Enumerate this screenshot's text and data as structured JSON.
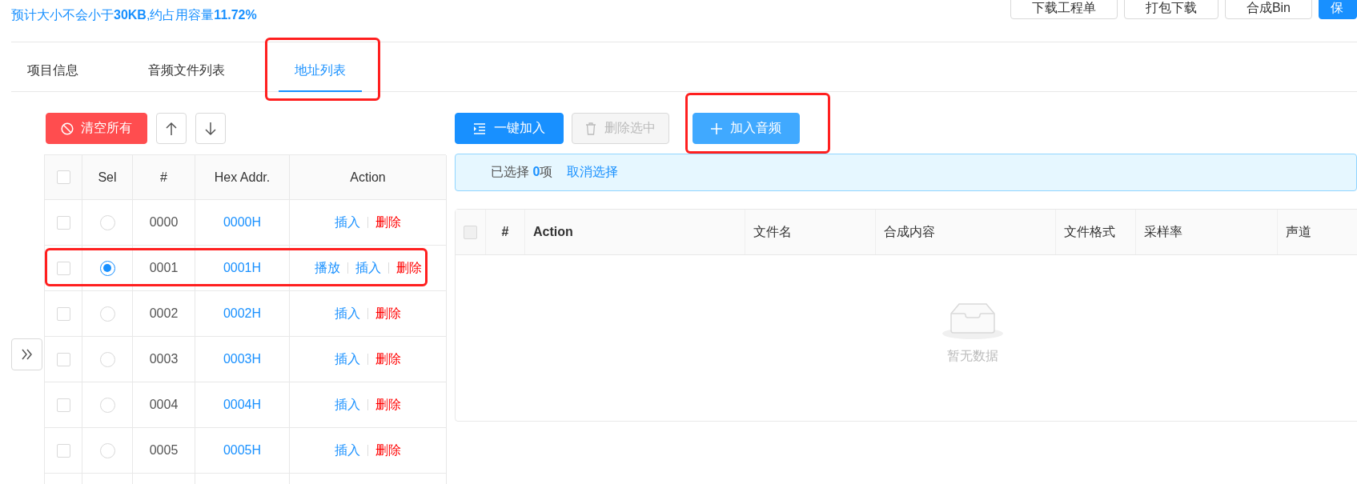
{
  "header": {
    "summary": "预计大小不会小于**30KB**,约占用容量**11.72%**",
    "buttons": [
      {
        "label": "下载工程单",
        "kind": "default"
      },
      {
        "label": "打包下载",
        "kind": "default"
      },
      {
        "label": "合成Bin",
        "kind": "default"
      },
      {
        "label": "保",
        "kind": "primary"
      }
    ]
  },
  "tabs": [
    {
      "label": "项目信息",
      "selected": false,
      "highlighted": false
    },
    {
      "label": "音频文件列表",
      "selected": false,
      "highlighted": false
    },
    {
      "label": "地址列表",
      "selected": true,
      "highlighted": true
    }
  ],
  "address_panel": {
    "clear_button": "清空所有",
    "table": {
      "select_all": {
        "checked": false
      },
      "columns": [
        "Sel",
        "#",
        "Hex Addr.",
        "Action"
      ],
      "rows": [
        {
          "checked": false,
          "selected": false,
          "highlighted": false,
          "index": "0000",
          "address": "0000H",
          "actions": [
            {
              "label": "插入",
              "kind": "link"
            },
            {
              "label": "删除",
              "kind": "danger"
            }
          ]
        },
        {
          "checked": false,
          "selected": true,
          "highlighted": true,
          "index": "0001",
          "address": "0001H",
          "actions": [
            {
              "label": "播放",
              "kind": "link"
            },
            {
              "label": "插入",
              "kind": "link"
            },
            {
              "label": "删除",
              "kind": "danger"
            }
          ]
        },
        {
          "checked": false,
          "selected": false,
          "highlighted": false,
          "index": "0002",
          "address": "0002H",
          "actions": [
            {
              "label": "插入",
              "kind": "link"
            },
            {
              "label": "删除",
              "kind": "danger"
            }
          ]
        },
        {
          "checked": false,
          "selected": false,
          "highlighted": false,
          "index": "0003",
          "address": "0003H",
          "actions": [
            {
              "label": "插入",
              "kind": "link"
            },
            {
              "label": "删除",
              "kind": "danger"
            }
          ]
        },
        {
          "checked": false,
          "selected": false,
          "highlighted": false,
          "index": "0004",
          "address": "0004H",
          "actions": [
            {
              "label": "插入",
              "kind": "link"
            },
            {
              "label": "删除",
              "kind": "danger"
            }
          ]
        },
        {
          "checked": false,
          "selected": false,
          "highlighted": false,
          "index": "0005",
          "address": "0005H",
          "actions": [
            {
              "label": "插入",
              "kind": "link"
            },
            {
              "label": "删除",
              "kind": "danger"
            }
          ]
        }
      ]
    }
  },
  "audio_panel": {
    "buttons": [
      {
        "label": "一键加入",
        "kind": "primary",
        "disabled": false,
        "highlighted": false
      },
      {
        "label": "删除选中",
        "kind": "default",
        "disabled": true,
        "highlighted": false
      },
      {
        "label": "加入音频",
        "kind": "light",
        "disabled": false,
        "highlighted": true
      }
    ],
    "selection": {
      "text": "已选择 **0**项",
      "clear_link": "取消选择"
    },
    "table": {
      "select_all": {
        "checked": false,
        "disabled": true
      },
      "columns": [
        "#",
        "Action",
        "文件名",
        "合成内容",
        "文件格式",
        "采样率",
        "声道"
      ],
      "empty_text": "暂无数据"
    }
  }
}
